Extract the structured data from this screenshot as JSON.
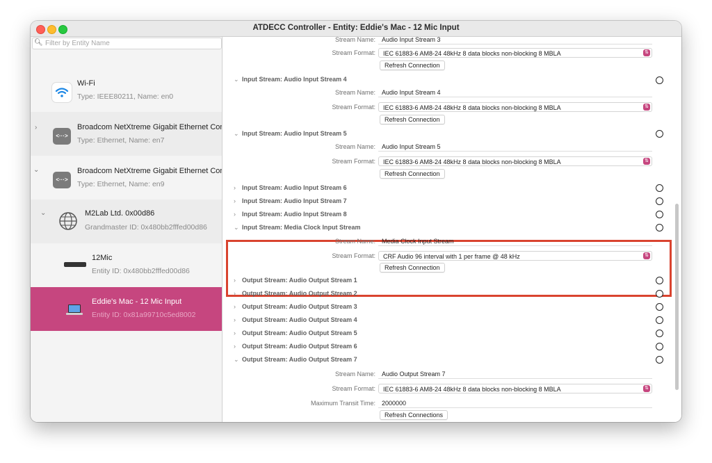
{
  "window": {
    "title": "ATDECC Controller - Entity: Eddie's Mac - 12 Mic Input"
  },
  "sidebar": {
    "filter_placeholder": "Filter by Entity Name",
    "items": [
      {
        "name": "Wi-Fi",
        "sub": "Type: IEEE80211, Name: en0",
        "icon": "wifi-icon"
      },
      {
        "name": "Broadcom NetXtreme Gigabit Ethernet Controller",
        "sub": "Type: Ethernet, Name: en7",
        "icon": "ethernet-icon",
        "chevron": ">"
      },
      {
        "name": "Broadcom NetXtreme Gigabit Ethernet Controller",
        "sub": "Type: Ethernet, Name: en9",
        "icon": "ethernet-icon",
        "chevron": "v"
      },
      {
        "name": "M2Lab Ltd. 0x00d86",
        "sub": "Grandmaster ID: 0x480bb2fffed00d86",
        "icon": "globe-icon",
        "chevron": "v"
      },
      {
        "name": "12Mic",
        "sub": "Entity ID: 0x480bb2fffed00d86",
        "icon": "device-icon"
      },
      {
        "name": "Eddie's Mac - 12 Mic Input",
        "sub": "Entity ID: 0x81a99710c5ed8002",
        "icon": "laptop-icon",
        "selected": true
      }
    ]
  },
  "labels": {
    "stream_name": "Stream Name:",
    "stream_format": "Stream Format:",
    "max_transit": "Maximum Transit Time:",
    "refresh": "Refresh Connection",
    "refresh_plural": "Refresh Connections"
  },
  "streams": {
    "s3_name": "Audio Input Stream 3",
    "s3_format": "IEC 61883-6 AM8-24 48kHz 8 data blocks non-blocking 8 MBLA",
    "s4_header": "Input Stream: Audio Input Stream 4",
    "s4_name": "Audio Input Stream 4",
    "s4_format": "IEC 61883-6 AM8-24 48kHz 8 data blocks non-blocking 8 MBLA",
    "s5_header": "Input Stream: Audio Input Stream 5",
    "s5_name": "Audio Input Stream 5",
    "s5_format": "IEC 61883-6 AM8-24 48kHz 8 data blocks non-blocking 8 MBLA",
    "s6_header": "Input Stream: Audio Input Stream 6",
    "s7_header": "Input Stream: Audio Input Stream 7",
    "s8_header": "Input Stream: Audio Input Stream 8",
    "mc_header": "Input Stream: Media Clock Input Stream",
    "mc_name": "Media Clock Input Stream",
    "mc_format": "CRF Audio 96 interval with 1 per frame @ 48 kHz",
    "o1_header": "Output Stream: Audio Output Stream 1",
    "o2_header": "Output Stream: Audio Output Stream 2",
    "o3_header": "Output Stream: Audio Output Stream 3",
    "o4_header": "Output Stream: Audio Output Stream 4",
    "o5_header": "Output Stream: Audio Output Stream 5",
    "o6_header": "Output Stream: Audio Output Stream 6",
    "o7_header": "Output Stream: Audio Output Stream 7",
    "o7_name": "Audio Output Stream 7",
    "o7_format": "IEC 61883-6 AM8-24 48kHz 8 data blocks non-blocking 8 MBLA",
    "o7_transit": "2000000"
  },
  "colors": {
    "accent": "#c6467f",
    "highlight": "#d9432f"
  }
}
